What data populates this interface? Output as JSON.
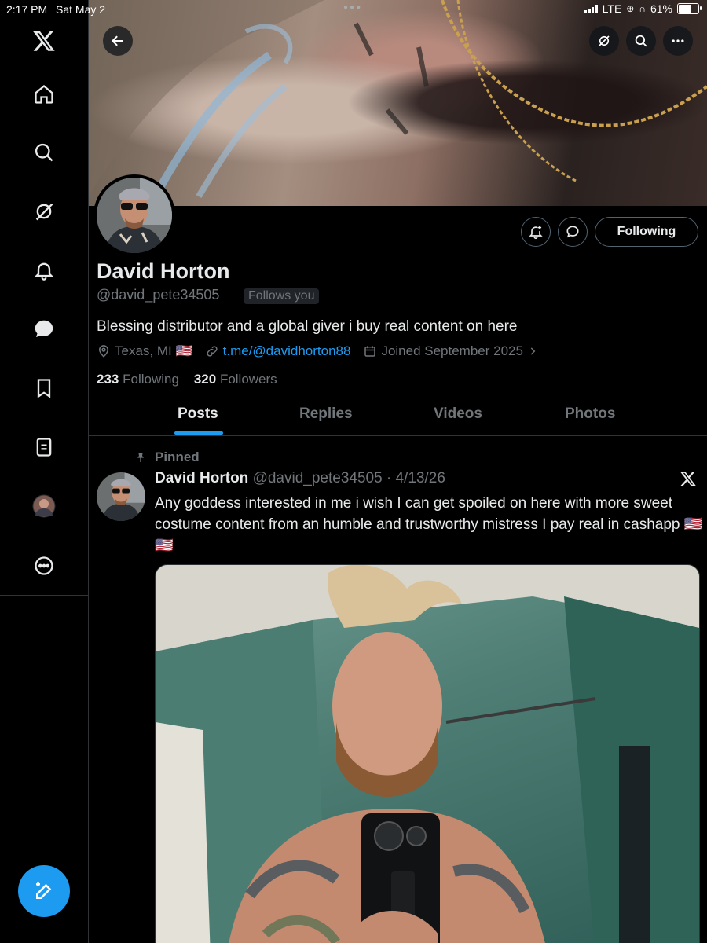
{
  "status_bar": {
    "time": "2:17 PM",
    "date": "Sat May 2",
    "network": "LTE",
    "battery": "61%",
    "battery_level": 0.61
  },
  "nav": {
    "items": [
      {
        "name": "x-logo-icon"
      },
      {
        "name": "home-icon"
      },
      {
        "name": "search-icon"
      },
      {
        "name": "grok-icon"
      },
      {
        "name": "notifications-icon"
      },
      {
        "name": "messages-icon"
      },
      {
        "name": "bookmarks-icon"
      },
      {
        "name": "lists-icon"
      },
      {
        "name": "profile-avatar"
      },
      {
        "name": "more-icon"
      }
    ],
    "compose_icon": "compose-icon"
  },
  "profile": {
    "name": "David Horton",
    "handle": "@david_pete34505",
    "follows_you": "Follows you",
    "bio": "Blessing distributor and a global giver i buy real content on here",
    "location": "Texas, MI 🇺🇸",
    "link": "t.me/@davidhorton88",
    "joined": "Joined September 2025",
    "following_count": "233",
    "following_label": "Following",
    "followers_count": "320",
    "followers_label": "Followers",
    "follow_button": "Following"
  },
  "tabs": [
    {
      "label": "Posts",
      "active": true
    },
    {
      "label": "Replies",
      "active": false
    },
    {
      "label": "Videos",
      "active": false
    },
    {
      "label": "Photos",
      "active": false
    }
  ],
  "pinned_post": {
    "pinned_label": "Pinned",
    "author": "David Horton",
    "handle_date": "@david_pete34505 · 4/13/26",
    "text": "Any goddess interested in me i wish I can get spoiled on here with more sweet costume content from an humble and trustworthy mistress I pay real in cashapp 🇺🇸🇺🇸"
  },
  "colors": {
    "accent": "#1d9bf0",
    "background": "#000000",
    "text": "#e7e9ea",
    "muted": "#71767b",
    "border": "#2f3336"
  }
}
